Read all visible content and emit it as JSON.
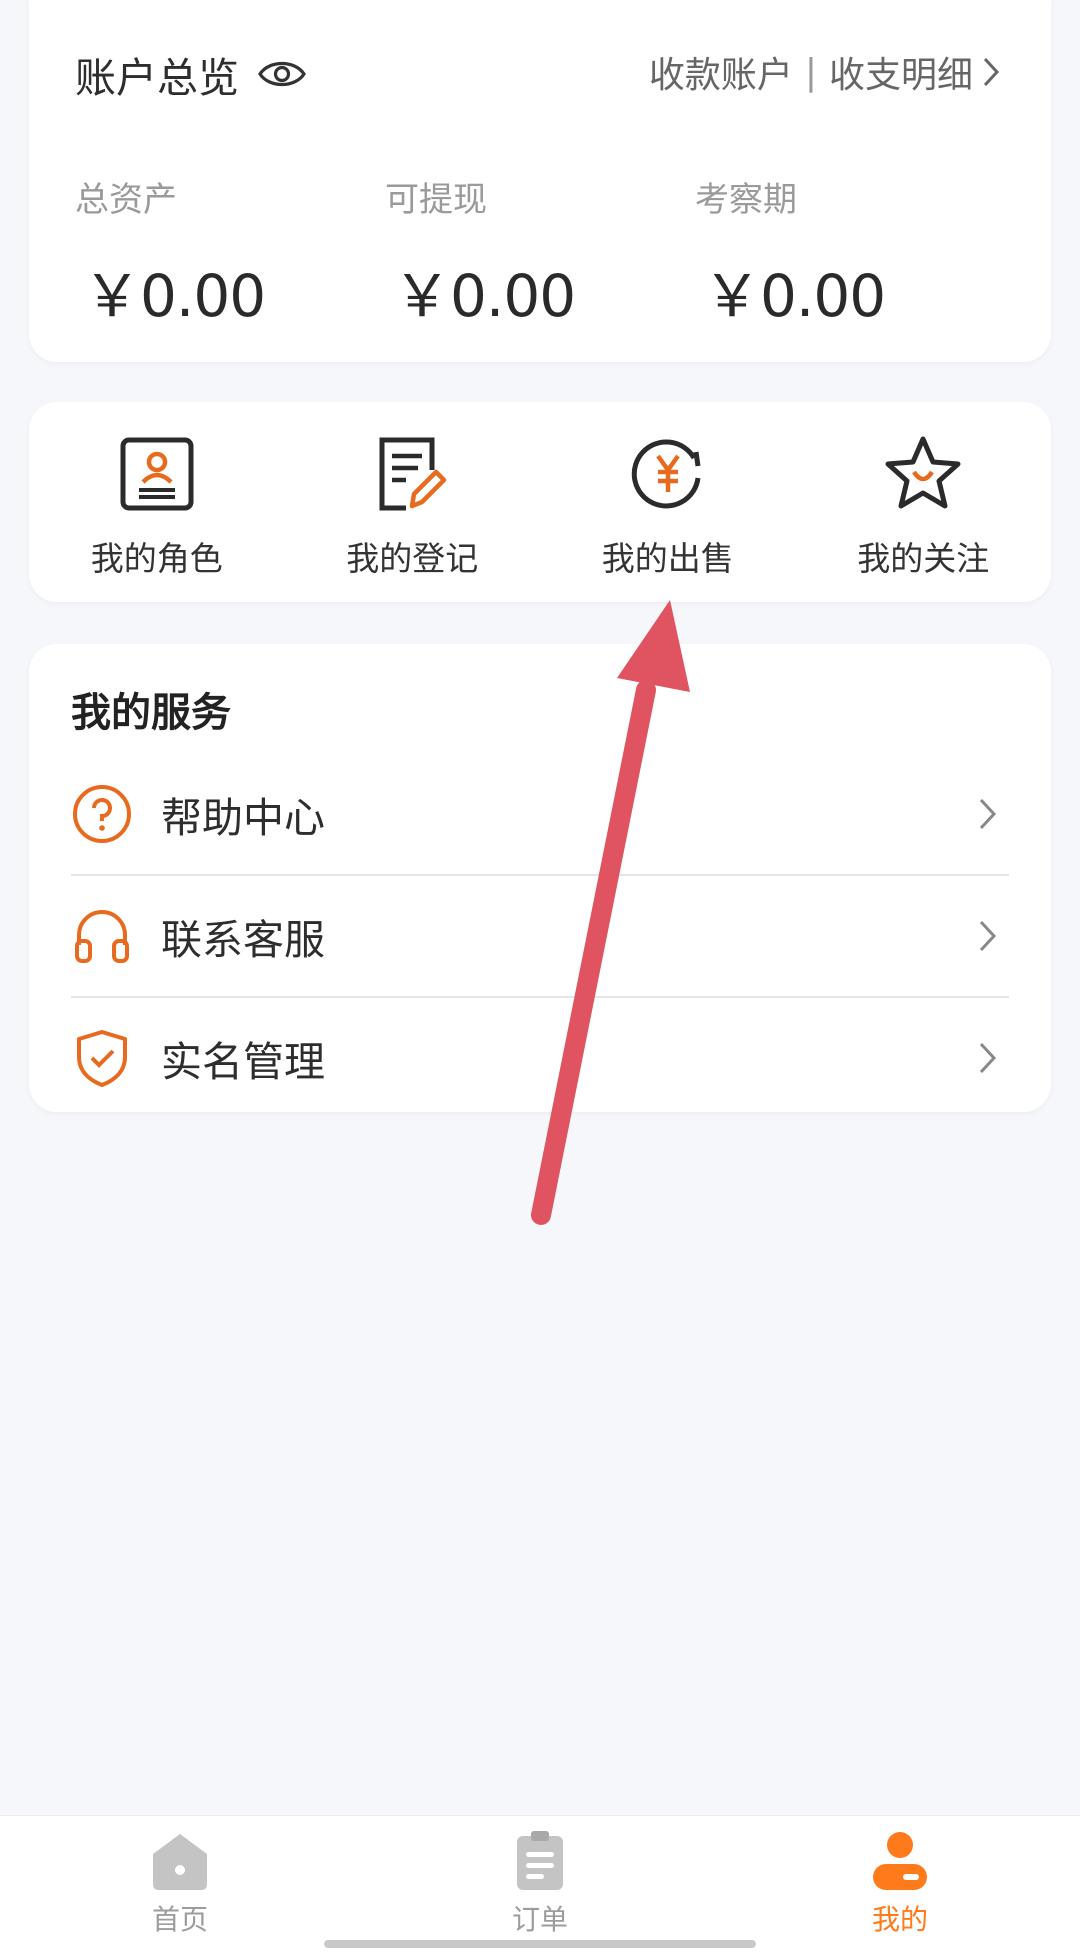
{
  "account": {
    "title": "账户总览",
    "eye_icon": "eye-icon",
    "link_accounts": "收款账户",
    "separator": "|",
    "link_details": "收支明细",
    "stats": [
      {
        "label": "总资产",
        "value": "￥0.00"
      },
      {
        "label": "可提现",
        "value": "￥0.00"
      },
      {
        "label": "考察期",
        "value": "￥0.00"
      }
    ]
  },
  "actions": [
    {
      "label": "我的角色",
      "icon": "role-card-icon"
    },
    {
      "label": "我的登记",
      "icon": "register-edit-icon"
    },
    {
      "label": "我的出售",
      "icon": "yuan-sale-icon"
    },
    {
      "label": "我的关注",
      "icon": "star-icon"
    }
  ],
  "services": {
    "title": "我的服务",
    "items": [
      {
        "label": "帮助中心",
        "icon": "help-icon"
      },
      {
        "label": "联系客服",
        "icon": "headset-icon"
      },
      {
        "label": "实名管理",
        "icon": "shield-check-icon"
      }
    ]
  },
  "nav": {
    "items": [
      {
        "label": "首页",
        "icon": "home-icon",
        "active": false
      },
      {
        "label": "订单",
        "icon": "order-icon",
        "active": false
      },
      {
        "label": "我的",
        "icon": "profile-icon",
        "active": true
      }
    ]
  },
  "colors": {
    "accent": "#ff7a1a",
    "icon_orange": "#e86a1f",
    "arrow": "#e05461",
    "background": "#f6f7fa"
  }
}
